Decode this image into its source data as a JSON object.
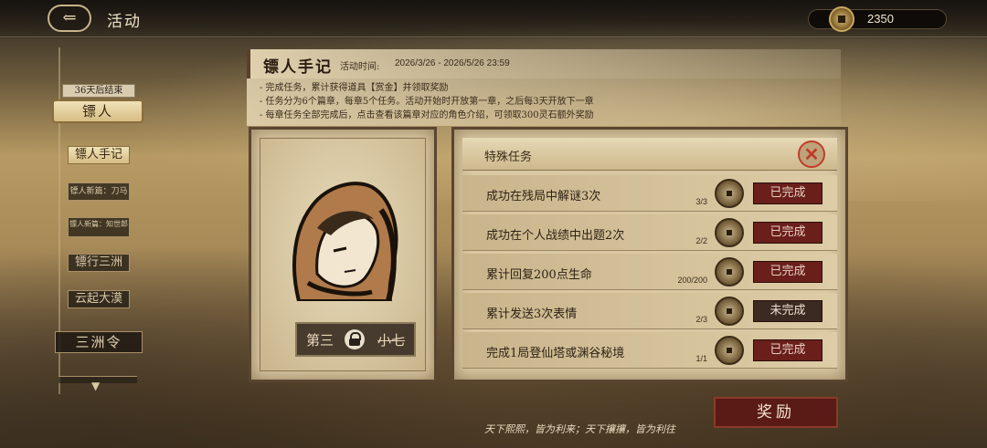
{
  "header": {
    "title": "活动",
    "back_icon": "back-arrow-icon",
    "currency_icon": "coin-icon",
    "currency_value": "2350"
  },
  "sidebar": {
    "deadline": "36天后结束",
    "event_tab": "镖人",
    "items": [
      {
        "label": "镖人手记",
        "active": true
      },
      {
        "label": "镖人新篇：刀马"
      },
      {
        "label": "镖人新篇：知世郎"
      },
      {
        "label": "镖行三洲"
      },
      {
        "label": "云起大漠"
      }
    ],
    "bottom_item": "三洲令",
    "more_icon": "chevron-down-icon"
  },
  "panel": {
    "title": "镖人手记",
    "period_label": "活动时间:",
    "period_value": "2026/3/26 - 2026/5/26 23:59",
    "rules": [
      "- 完成任务，累计获得道具【赏金】并领取奖励",
      "- 任务分为6个篇章，每章5个任务。活动开始时开放第一章，之后每3天开放下一章",
      "- 每章任务全部完成后，点击查看该篇章对应的角色介绍，可领取300灵石额外奖励"
    ]
  },
  "portrait": {
    "chapter_label": "第三",
    "chapter_locked_name": "小七",
    "lock_icon": "lock-icon"
  },
  "tasks": {
    "header": "特殊任务",
    "close_icon": "close-icon",
    "items": [
      {
        "name": "成功在残局中解谜3次",
        "progress": "3/3",
        "status": "已完成"
      },
      {
        "name": "成功在个人战绩中出题2次",
        "progress": "2/2",
        "status": "已完成"
      },
      {
        "name": "累计回复200点生命",
        "progress": "200/200",
        "status": "已完成"
      },
      {
        "name": "累计发送3次表情",
        "progress": "2/3",
        "status": "未完成"
      },
      {
        "name": "完成1局登仙塔或渊谷秘境",
        "progress": "1/1",
        "status": "已完成"
      }
    ]
  },
  "reward_button": "奖励",
  "footer_quote": "天下熙熙，皆为利来；天下攘攘，皆为利往",
  "colors": {
    "completed": "#6a1f1a",
    "pending": "#3a2a22",
    "accent_gold": "#c9a860"
  }
}
